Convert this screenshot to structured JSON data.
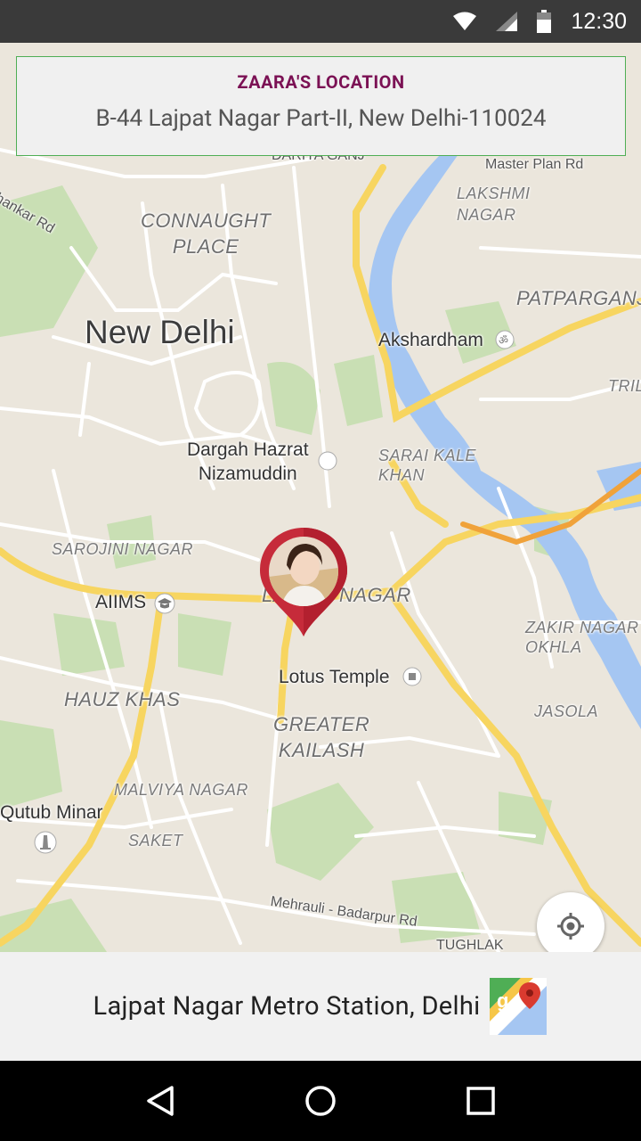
{
  "status_bar": {
    "time": "12:30"
  },
  "location_card": {
    "title": "ZAARA'S LOCATION",
    "address": "B-44 Lajpat Nagar Part-II, New Delhi-110024"
  },
  "map": {
    "labels": {
      "connaught": "CONNAUGHT\nPLACE",
      "new_delhi": "New Delhi",
      "akshardham": "Akshardham",
      "dargah": "Dargah Hazrat\nNizamuddin",
      "sarai_kale_khan": "SARAI KALE\nKHAN",
      "sarojini": "SAROJINI NAGAR",
      "aiims": "AIIMS",
      "lajpat": "LAJPAT NAGAR",
      "lotus": "Lotus Temple",
      "hauz_khas": "HAUZ KHAS",
      "greater_kailash": "GREATER\nKAILASH",
      "malviya": "MALVIYA NAGAR",
      "qutub": "Qutub Minar",
      "saket": "SAKET",
      "lakshmi": "LAKSHMI\nNAGAR",
      "patparganj": "PATPARGANJ",
      "zakir": "ZAKIR NAGAR\nOKHLA",
      "jasola": "JASOLA",
      "trilok": "TRILO",
      "master_plan": "Master Plan Rd",
      "mehrauli": "Mehrauli - Badarpur Rd",
      "dariya": "DARIYA GANJ",
      "chankar": "Chankar Rd",
      "tughlak": "TUGHLAK"
    }
  },
  "bottom_bar": {
    "place": "Lajpat Nagar Metro Station, Delhi"
  },
  "colors": {
    "title": "#7b1154",
    "marker": "#c62b3a",
    "major_road": "#f7d560",
    "river": "#a5c6f2"
  }
}
